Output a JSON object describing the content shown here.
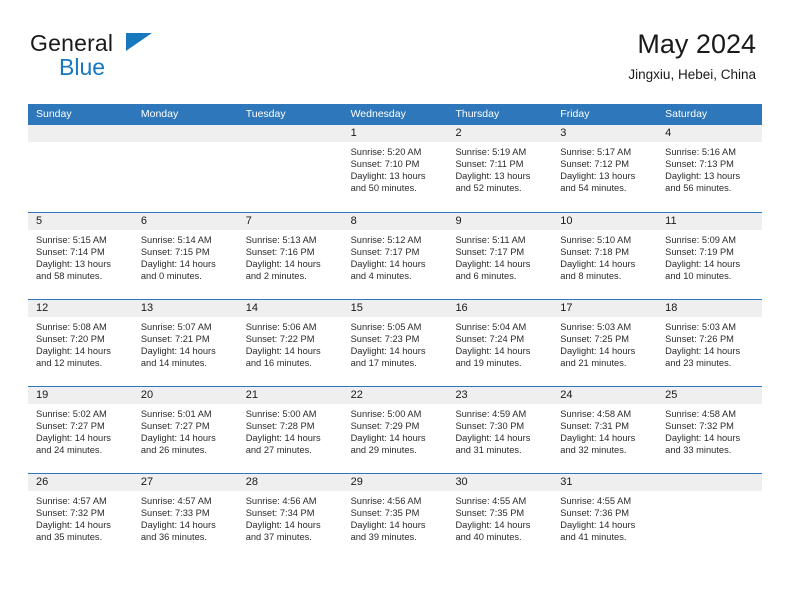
{
  "brand": {
    "name_part1": "General",
    "name_part2": "Blue",
    "flag_icon": "triangle-flag-icon",
    "accent_color": "#1878be"
  },
  "header": {
    "title": "May 2024",
    "location": "Jingxiu, Hebei, China"
  },
  "theme": {
    "header_bar_color": "#2e77ba",
    "day_number_bg": "#efefef",
    "text_color": "#222222"
  },
  "calendar": {
    "day_headers": [
      "Sunday",
      "Monday",
      "Tuesday",
      "Wednesday",
      "Thursday",
      "Friday",
      "Saturday"
    ],
    "weeks": [
      [
        {
          "day": "",
          "empty": true
        },
        {
          "day": "",
          "empty": true
        },
        {
          "day": "",
          "empty": true
        },
        {
          "day": "1",
          "sunrise": "Sunrise: 5:20 AM",
          "sunset": "Sunset: 7:10 PM",
          "daylight": "Daylight: 13 hours and 50 minutes."
        },
        {
          "day": "2",
          "sunrise": "Sunrise: 5:19 AM",
          "sunset": "Sunset: 7:11 PM",
          "daylight": "Daylight: 13 hours and 52 minutes."
        },
        {
          "day": "3",
          "sunrise": "Sunrise: 5:17 AM",
          "sunset": "Sunset: 7:12 PM",
          "daylight": "Daylight: 13 hours and 54 minutes."
        },
        {
          "day": "4",
          "sunrise": "Sunrise: 5:16 AM",
          "sunset": "Sunset: 7:13 PM",
          "daylight": "Daylight: 13 hours and 56 minutes."
        }
      ],
      [
        {
          "day": "5",
          "sunrise": "Sunrise: 5:15 AM",
          "sunset": "Sunset: 7:14 PM",
          "daylight": "Daylight: 13 hours and 58 minutes."
        },
        {
          "day": "6",
          "sunrise": "Sunrise: 5:14 AM",
          "sunset": "Sunset: 7:15 PM",
          "daylight": "Daylight: 14 hours and 0 minutes."
        },
        {
          "day": "7",
          "sunrise": "Sunrise: 5:13 AM",
          "sunset": "Sunset: 7:16 PM",
          "daylight": "Daylight: 14 hours and 2 minutes."
        },
        {
          "day": "8",
          "sunrise": "Sunrise: 5:12 AM",
          "sunset": "Sunset: 7:17 PM",
          "daylight": "Daylight: 14 hours and 4 minutes."
        },
        {
          "day": "9",
          "sunrise": "Sunrise: 5:11 AM",
          "sunset": "Sunset: 7:17 PM",
          "daylight": "Daylight: 14 hours and 6 minutes."
        },
        {
          "day": "10",
          "sunrise": "Sunrise: 5:10 AM",
          "sunset": "Sunset: 7:18 PM",
          "daylight": "Daylight: 14 hours and 8 minutes."
        },
        {
          "day": "11",
          "sunrise": "Sunrise: 5:09 AM",
          "sunset": "Sunset: 7:19 PM",
          "daylight": "Daylight: 14 hours and 10 minutes."
        }
      ],
      [
        {
          "day": "12",
          "sunrise": "Sunrise: 5:08 AM",
          "sunset": "Sunset: 7:20 PM",
          "daylight": "Daylight: 14 hours and 12 minutes."
        },
        {
          "day": "13",
          "sunrise": "Sunrise: 5:07 AM",
          "sunset": "Sunset: 7:21 PM",
          "daylight": "Daylight: 14 hours and 14 minutes."
        },
        {
          "day": "14",
          "sunrise": "Sunrise: 5:06 AM",
          "sunset": "Sunset: 7:22 PM",
          "daylight": "Daylight: 14 hours and 16 minutes."
        },
        {
          "day": "15",
          "sunrise": "Sunrise: 5:05 AM",
          "sunset": "Sunset: 7:23 PM",
          "daylight": "Daylight: 14 hours and 17 minutes."
        },
        {
          "day": "16",
          "sunrise": "Sunrise: 5:04 AM",
          "sunset": "Sunset: 7:24 PM",
          "daylight": "Daylight: 14 hours and 19 minutes."
        },
        {
          "day": "17",
          "sunrise": "Sunrise: 5:03 AM",
          "sunset": "Sunset: 7:25 PM",
          "daylight": "Daylight: 14 hours and 21 minutes."
        },
        {
          "day": "18",
          "sunrise": "Sunrise: 5:03 AM",
          "sunset": "Sunset: 7:26 PM",
          "daylight": "Daylight: 14 hours and 23 minutes."
        }
      ],
      [
        {
          "day": "19",
          "sunrise": "Sunrise: 5:02 AM",
          "sunset": "Sunset: 7:27 PM",
          "daylight": "Daylight: 14 hours and 24 minutes."
        },
        {
          "day": "20",
          "sunrise": "Sunrise: 5:01 AM",
          "sunset": "Sunset: 7:27 PM",
          "daylight": "Daylight: 14 hours and 26 minutes."
        },
        {
          "day": "21",
          "sunrise": "Sunrise: 5:00 AM",
          "sunset": "Sunset: 7:28 PM",
          "daylight": "Daylight: 14 hours and 27 minutes."
        },
        {
          "day": "22",
          "sunrise": "Sunrise: 5:00 AM",
          "sunset": "Sunset: 7:29 PM",
          "daylight": "Daylight: 14 hours and 29 minutes."
        },
        {
          "day": "23",
          "sunrise": "Sunrise: 4:59 AM",
          "sunset": "Sunset: 7:30 PM",
          "daylight": "Daylight: 14 hours and 31 minutes."
        },
        {
          "day": "24",
          "sunrise": "Sunrise: 4:58 AM",
          "sunset": "Sunset: 7:31 PM",
          "daylight": "Daylight: 14 hours and 32 minutes."
        },
        {
          "day": "25",
          "sunrise": "Sunrise: 4:58 AM",
          "sunset": "Sunset: 7:32 PM",
          "daylight": "Daylight: 14 hours and 33 minutes."
        }
      ],
      [
        {
          "day": "26",
          "sunrise": "Sunrise: 4:57 AM",
          "sunset": "Sunset: 7:32 PM",
          "daylight": "Daylight: 14 hours and 35 minutes."
        },
        {
          "day": "27",
          "sunrise": "Sunrise: 4:57 AM",
          "sunset": "Sunset: 7:33 PM",
          "daylight": "Daylight: 14 hours and 36 minutes."
        },
        {
          "day": "28",
          "sunrise": "Sunrise: 4:56 AM",
          "sunset": "Sunset: 7:34 PM",
          "daylight": "Daylight: 14 hours and 37 minutes."
        },
        {
          "day": "29",
          "sunrise": "Sunrise: 4:56 AM",
          "sunset": "Sunset: 7:35 PM",
          "daylight": "Daylight: 14 hours and 39 minutes."
        },
        {
          "day": "30",
          "sunrise": "Sunrise: 4:55 AM",
          "sunset": "Sunset: 7:35 PM",
          "daylight": "Daylight: 14 hours and 40 minutes."
        },
        {
          "day": "31",
          "sunrise": "Sunrise: 4:55 AM",
          "sunset": "Sunset: 7:36 PM",
          "daylight": "Daylight: 14 hours and 41 minutes."
        },
        {
          "day": "",
          "empty": true
        }
      ]
    ]
  }
}
